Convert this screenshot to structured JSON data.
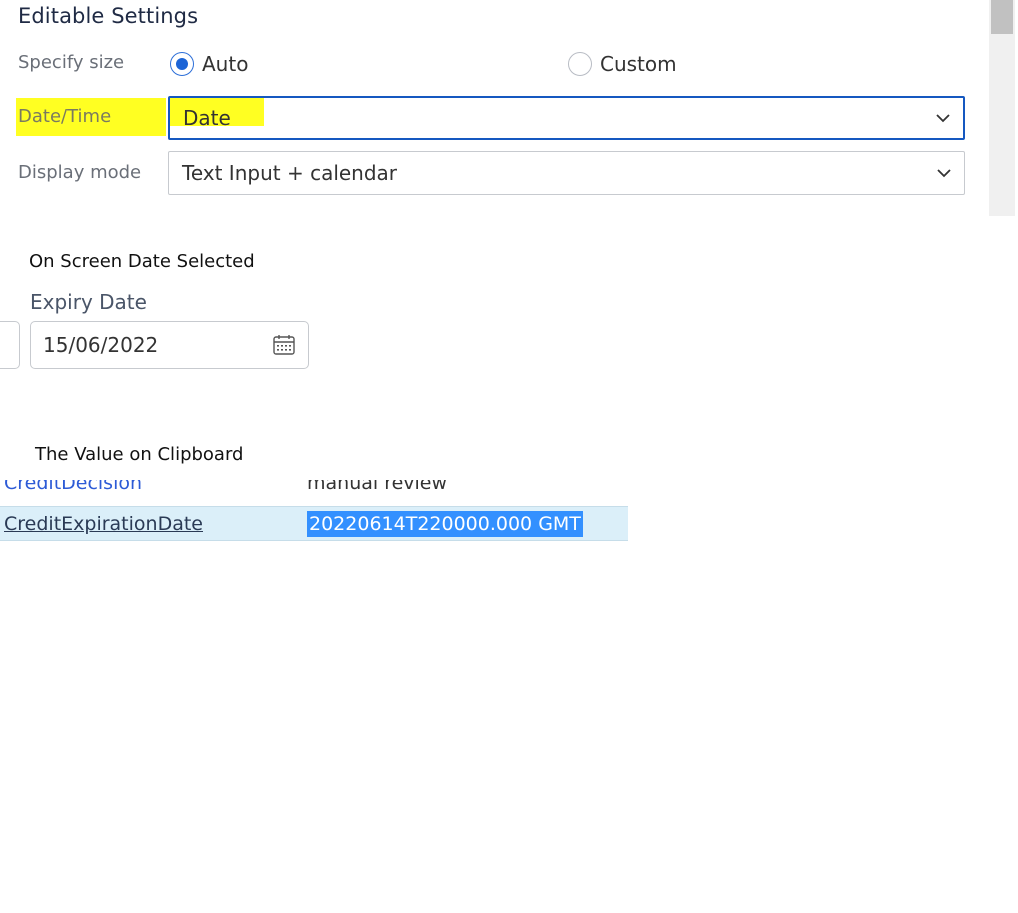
{
  "editable_settings": {
    "title": "Editable Settings",
    "specify_size": {
      "label": "Specify size",
      "options": [
        {
          "label": "Auto",
          "selected": true
        },
        {
          "label": "Custom",
          "selected": false
        }
      ]
    },
    "date_time": {
      "label": "Date/Time",
      "selected": "Date"
    },
    "display_mode": {
      "label": "Display mode",
      "selected": "Text Input + calendar"
    }
  },
  "on_screen": {
    "caption": "On Screen Date Selected",
    "field_label": "Expiry Date",
    "field_value": "15/06/2022"
  },
  "clipboard": {
    "caption": "The Value on Clipboard",
    "rows": [
      {
        "key": "CreditDecision",
        "value": "manual review"
      },
      {
        "key": "CreditExpirationDate",
        "value": "20220614T220000.000 GMT"
      }
    ]
  },
  "colors": {
    "highlight": "#ffff22",
    "accent": "#1c64d6",
    "selection": "#3390ff",
    "row_highlight": "#dbeff9"
  }
}
